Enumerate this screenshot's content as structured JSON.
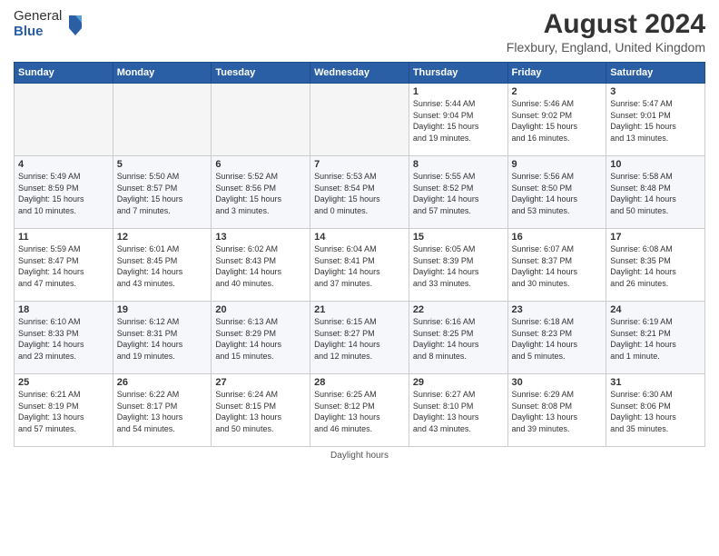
{
  "header": {
    "logo_general": "General",
    "logo_blue": "Blue",
    "month_year": "August 2024",
    "location": "Flexbury, England, United Kingdom"
  },
  "days_of_week": [
    "Sunday",
    "Monday",
    "Tuesday",
    "Wednesday",
    "Thursday",
    "Friday",
    "Saturday"
  ],
  "footer": "Daylight hours",
  "weeks": [
    [
      {
        "num": "",
        "info": "",
        "empty": true
      },
      {
        "num": "",
        "info": "",
        "empty": true
      },
      {
        "num": "",
        "info": "",
        "empty": true
      },
      {
        "num": "",
        "info": "",
        "empty": true
      },
      {
        "num": "1",
        "info": "Sunrise: 5:44 AM\nSunset: 9:04 PM\nDaylight: 15 hours\nand 19 minutes."
      },
      {
        "num": "2",
        "info": "Sunrise: 5:46 AM\nSunset: 9:02 PM\nDaylight: 15 hours\nand 16 minutes."
      },
      {
        "num": "3",
        "info": "Sunrise: 5:47 AM\nSunset: 9:01 PM\nDaylight: 15 hours\nand 13 minutes."
      }
    ],
    [
      {
        "num": "4",
        "info": "Sunrise: 5:49 AM\nSunset: 8:59 PM\nDaylight: 15 hours\nand 10 minutes."
      },
      {
        "num": "5",
        "info": "Sunrise: 5:50 AM\nSunset: 8:57 PM\nDaylight: 15 hours\nand 7 minutes."
      },
      {
        "num": "6",
        "info": "Sunrise: 5:52 AM\nSunset: 8:56 PM\nDaylight: 15 hours\nand 3 minutes."
      },
      {
        "num": "7",
        "info": "Sunrise: 5:53 AM\nSunset: 8:54 PM\nDaylight: 15 hours\nand 0 minutes."
      },
      {
        "num": "8",
        "info": "Sunrise: 5:55 AM\nSunset: 8:52 PM\nDaylight: 14 hours\nand 57 minutes."
      },
      {
        "num": "9",
        "info": "Sunrise: 5:56 AM\nSunset: 8:50 PM\nDaylight: 14 hours\nand 53 minutes."
      },
      {
        "num": "10",
        "info": "Sunrise: 5:58 AM\nSunset: 8:48 PM\nDaylight: 14 hours\nand 50 minutes."
      }
    ],
    [
      {
        "num": "11",
        "info": "Sunrise: 5:59 AM\nSunset: 8:47 PM\nDaylight: 14 hours\nand 47 minutes."
      },
      {
        "num": "12",
        "info": "Sunrise: 6:01 AM\nSunset: 8:45 PM\nDaylight: 14 hours\nand 43 minutes."
      },
      {
        "num": "13",
        "info": "Sunrise: 6:02 AM\nSunset: 8:43 PM\nDaylight: 14 hours\nand 40 minutes."
      },
      {
        "num": "14",
        "info": "Sunrise: 6:04 AM\nSunset: 8:41 PM\nDaylight: 14 hours\nand 37 minutes."
      },
      {
        "num": "15",
        "info": "Sunrise: 6:05 AM\nSunset: 8:39 PM\nDaylight: 14 hours\nand 33 minutes."
      },
      {
        "num": "16",
        "info": "Sunrise: 6:07 AM\nSunset: 8:37 PM\nDaylight: 14 hours\nand 30 minutes."
      },
      {
        "num": "17",
        "info": "Sunrise: 6:08 AM\nSunset: 8:35 PM\nDaylight: 14 hours\nand 26 minutes."
      }
    ],
    [
      {
        "num": "18",
        "info": "Sunrise: 6:10 AM\nSunset: 8:33 PM\nDaylight: 14 hours\nand 23 minutes."
      },
      {
        "num": "19",
        "info": "Sunrise: 6:12 AM\nSunset: 8:31 PM\nDaylight: 14 hours\nand 19 minutes."
      },
      {
        "num": "20",
        "info": "Sunrise: 6:13 AM\nSunset: 8:29 PM\nDaylight: 14 hours\nand 15 minutes."
      },
      {
        "num": "21",
        "info": "Sunrise: 6:15 AM\nSunset: 8:27 PM\nDaylight: 14 hours\nand 12 minutes."
      },
      {
        "num": "22",
        "info": "Sunrise: 6:16 AM\nSunset: 8:25 PM\nDaylight: 14 hours\nand 8 minutes."
      },
      {
        "num": "23",
        "info": "Sunrise: 6:18 AM\nSunset: 8:23 PM\nDaylight: 14 hours\nand 5 minutes."
      },
      {
        "num": "24",
        "info": "Sunrise: 6:19 AM\nSunset: 8:21 PM\nDaylight: 14 hours\nand 1 minute."
      }
    ],
    [
      {
        "num": "25",
        "info": "Sunrise: 6:21 AM\nSunset: 8:19 PM\nDaylight: 13 hours\nand 57 minutes."
      },
      {
        "num": "26",
        "info": "Sunrise: 6:22 AM\nSunset: 8:17 PM\nDaylight: 13 hours\nand 54 minutes."
      },
      {
        "num": "27",
        "info": "Sunrise: 6:24 AM\nSunset: 8:15 PM\nDaylight: 13 hours\nand 50 minutes."
      },
      {
        "num": "28",
        "info": "Sunrise: 6:25 AM\nSunset: 8:12 PM\nDaylight: 13 hours\nand 46 minutes."
      },
      {
        "num": "29",
        "info": "Sunrise: 6:27 AM\nSunset: 8:10 PM\nDaylight: 13 hours\nand 43 minutes."
      },
      {
        "num": "30",
        "info": "Sunrise: 6:29 AM\nSunset: 8:08 PM\nDaylight: 13 hours\nand 39 minutes."
      },
      {
        "num": "31",
        "info": "Sunrise: 6:30 AM\nSunset: 8:06 PM\nDaylight: 13 hours\nand 35 minutes."
      }
    ]
  ]
}
